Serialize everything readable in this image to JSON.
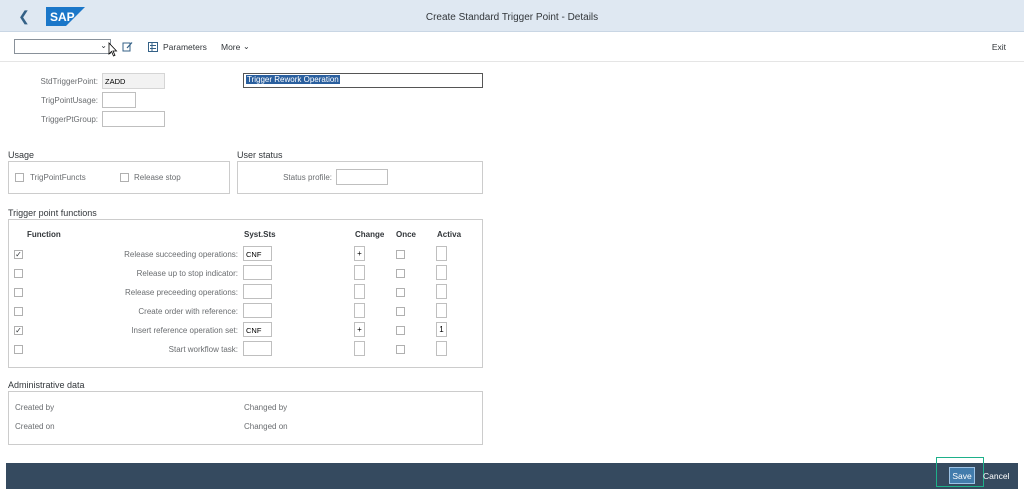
{
  "shell": {
    "title": "Create Standard Trigger Point - Details",
    "back_icon": "back-icon",
    "logo": "SAP"
  },
  "toolbar": {
    "variant_value": "",
    "parameters_label": "Parameters",
    "more_label": "More",
    "exit_label": "Exit"
  },
  "header": {
    "std_trigger_point_label": "StdTriggerPoint:",
    "std_trigger_point_value": "ZADD",
    "description_value": "Trigger Rework Operation",
    "trig_point_usage_label": "TrigPointUsage:",
    "trig_point_usage_value": "",
    "trigger_pt_group_label": "TriggerPtGroup:",
    "trigger_pt_group_value": ""
  },
  "usage": {
    "title": "Usage",
    "trig_point_functs_label": "TrigPointFuncts",
    "trig_point_functs_checked": false,
    "release_stop_label": "Release stop",
    "release_stop_checked": false
  },
  "user_status": {
    "title": "User status",
    "status_profile_label": "Status profile:",
    "status_profile_value": ""
  },
  "trigger_functions": {
    "title": "Trigger point functions",
    "headers": {
      "function": "Function",
      "syst_sts": "Syst.Sts",
      "change": "Change",
      "once": "Once",
      "activa": "Activa"
    },
    "rows": [
      {
        "checked": true,
        "label": "Release succeeding operations:",
        "syst_sts": "CNF",
        "change": "+",
        "once": false,
        "activa": ""
      },
      {
        "checked": false,
        "label": "Release up to stop indicator:",
        "syst_sts": "",
        "change": "",
        "once": false,
        "activa": ""
      },
      {
        "checked": false,
        "label": "Release preceeding operations:",
        "syst_sts": "",
        "change": "",
        "once": false,
        "activa": ""
      },
      {
        "checked": false,
        "label": "Create order with reference:",
        "syst_sts": "",
        "change": "",
        "once": false,
        "activa": ""
      },
      {
        "checked": true,
        "label": "Insert reference operation set:",
        "syst_sts": "CNF",
        "change": "+",
        "once": false,
        "activa": "1"
      },
      {
        "checked": false,
        "label": "Start workflow task:",
        "syst_sts": "",
        "change": "",
        "once": false,
        "activa": ""
      }
    ]
  },
  "admin": {
    "title": "Administrative data",
    "created_by_label": "Created by",
    "created_on_label": "Created on",
    "changed_by_label": "Changed by",
    "changed_on_label": "Changed on"
  },
  "footer": {
    "save_label": "Save",
    "cancel_label": "Cancel"
  },
  "colors": {
    "shell_bg": "#dfe8f2",
    "footer_bg": "#354a5f",
    "save_bg": "#427cac",
    "highlight": "#1eb08a"
  }
}
